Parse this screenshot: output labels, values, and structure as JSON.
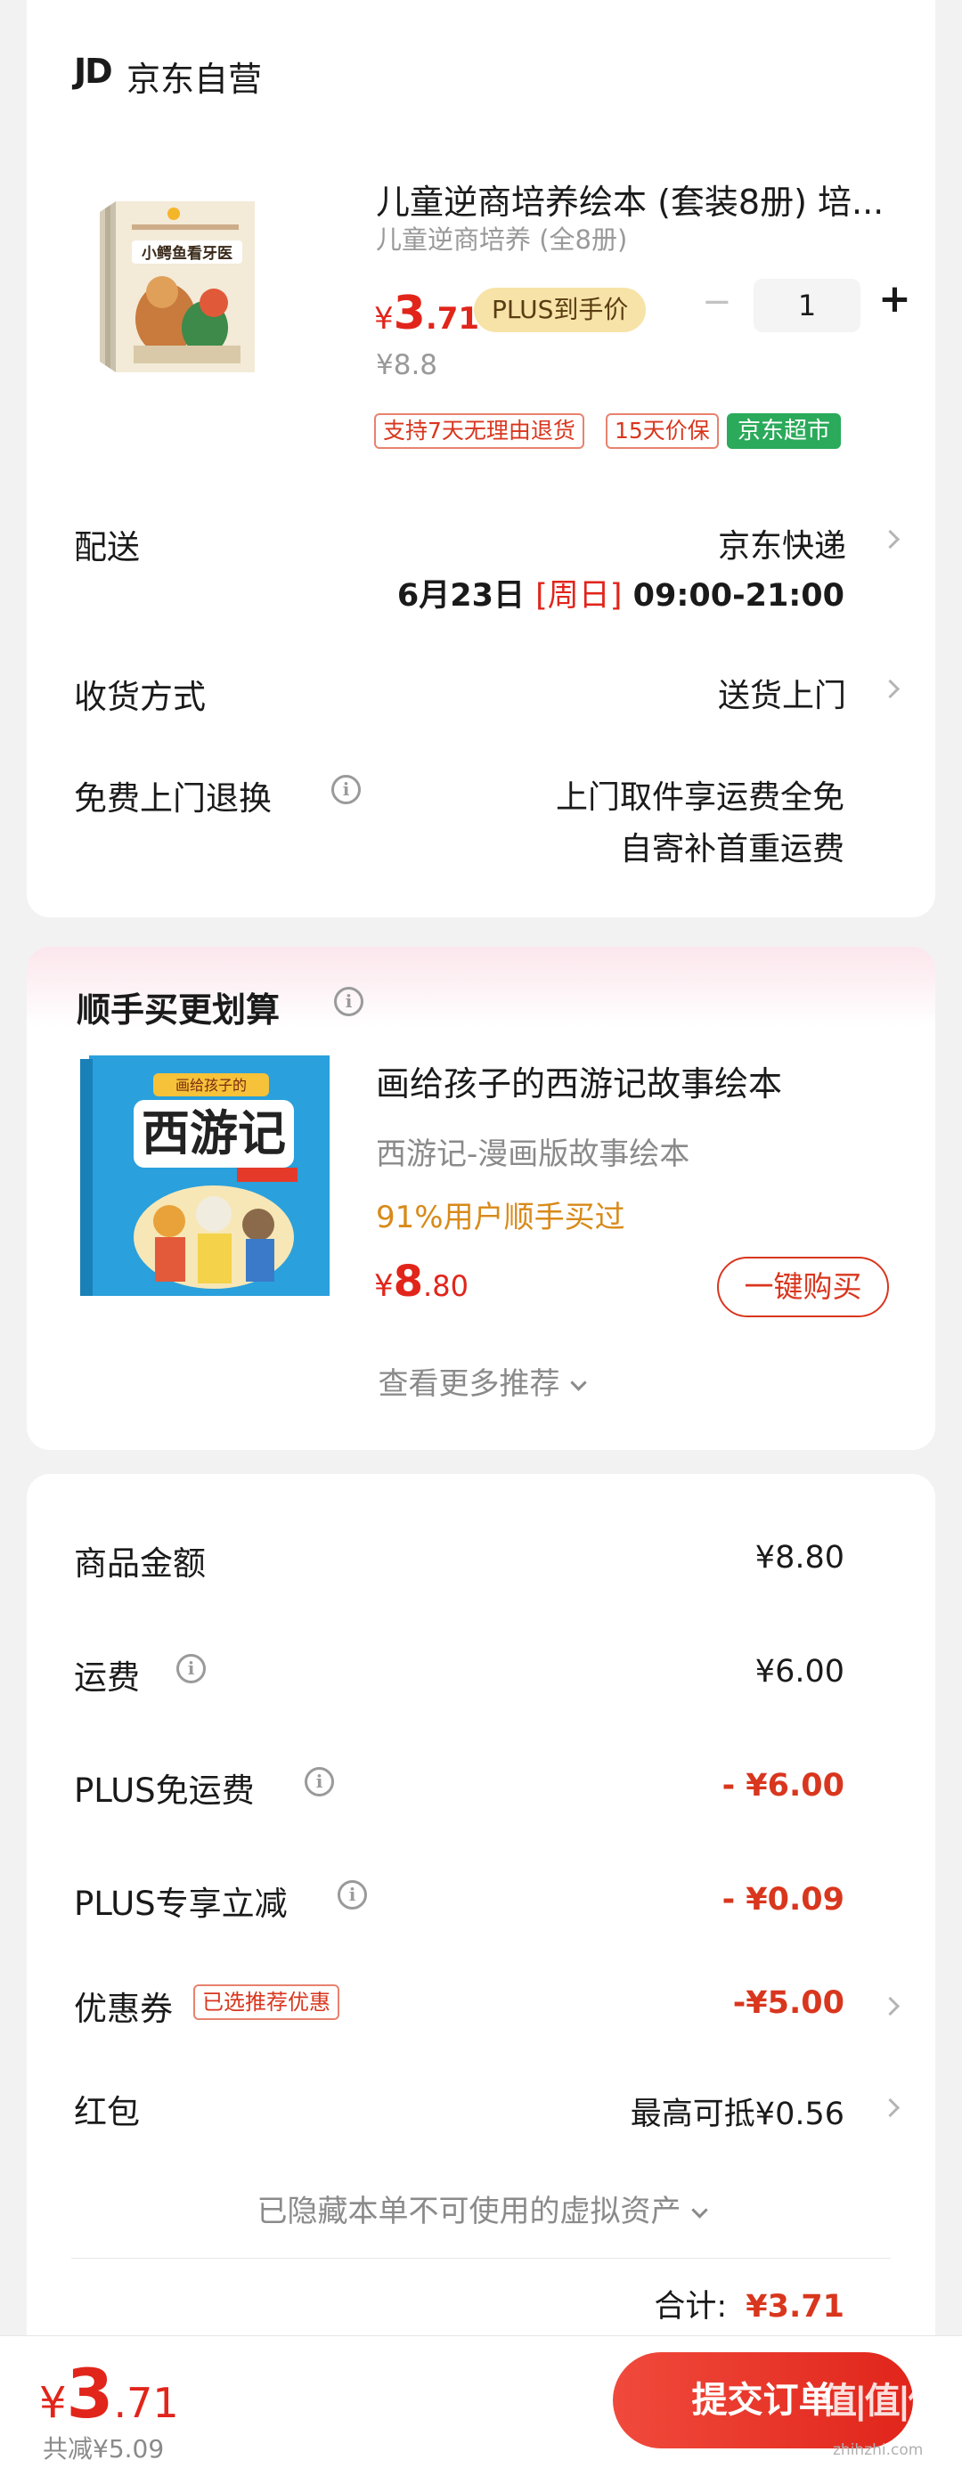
{
  "shop": {
    "logo": "JD",
    "name": "京东自营"
  },
  "product": {
    "title": "儿童逆商培养绘本 (套装8册) 培...",
    "subtitle": "儿童逆商培养 (全8册)",
    "cover_text": "小鳄鱼看牙医",
    "price_symbol": "¥",
    "price_int": "3",
    "price_dec": ".71",
    "plus_badge": "PLUS到手价",
    "original_price": "¥8.8",
    "quantity": "1",
    "minus": "−",
    "plus": "+",
    "tags": [
      "支持7天无理由退货",
      "15天价保"
    ],
    "green_tag": "京东超市"
  },
  "delivery": {
    "label": "配送",
    "carrier": "京东快递",
    "date": "6月23日",
    "weekday": "[周日]",
    "time": "09:00-21:00"
  },
  "receive": {
    "label": "收货方式",
    "value": "送货上门"
  },
  "free_return": {
    "label": "免费上门退换",
    "line1": "上门取件享运费全免",
    "line2": "自寄补首重运费"
  },
  "recommend": {
    "title": "顺手买更划算",
    "cover_text": "西游记",
    "cover_top": "画给孩子的",
    "name": "画给孩子的西游记故事绘本",
    "desc": "西游记-漫画版故事绘本",
    "stat": "91%用户顺手买过",
    "price_symbol": "¥",
    "price_int": "8",
    "price_dec": ".80",
    "buy_button": "一键购买",
    "more": "查看更多推荐"
  },
  "summary": {
    "rows": [
      {
        "label": "商品金额",
        "value": "¥8.80"
      },
      {
        "label": "运费",
        "value": "¥6.00"
      },
      {
        "label": "PLUS免运费",
        "value": "- ¥6.00"
      },
      {
        "label": "PLUS专享立减",
        "value": "- ¥0.09"
      },
      {
        "label": "优惠券",
        "tag": "已选推荐优惠",
        "value": "-¥5.00"
      },
      {
        "label": "红包",
        "value": "最高可抵¥0.56"
      }
    ],
    "hidden_assets": "已隐藏本单不可使用的虚拟资产",
    "total_label": "合计:",
    "total_value": "¥3.71"
  },
  "bottom_bar": {
    "price_symbol": "¥",
    "price_int": "3",
    "price_dec": ".71",
    "saved": "共减¥5.09",
    "submit": "提交订单",
    "watermark": "值|值|值",
    "watermark_sub": "zhihzhi.com"
  },
  "colors": {
    "accent_red": "#e1251b",
    "plus_gold": "#f7e3a8",
    "jd_green": "#2aaa5a"
  }
}
